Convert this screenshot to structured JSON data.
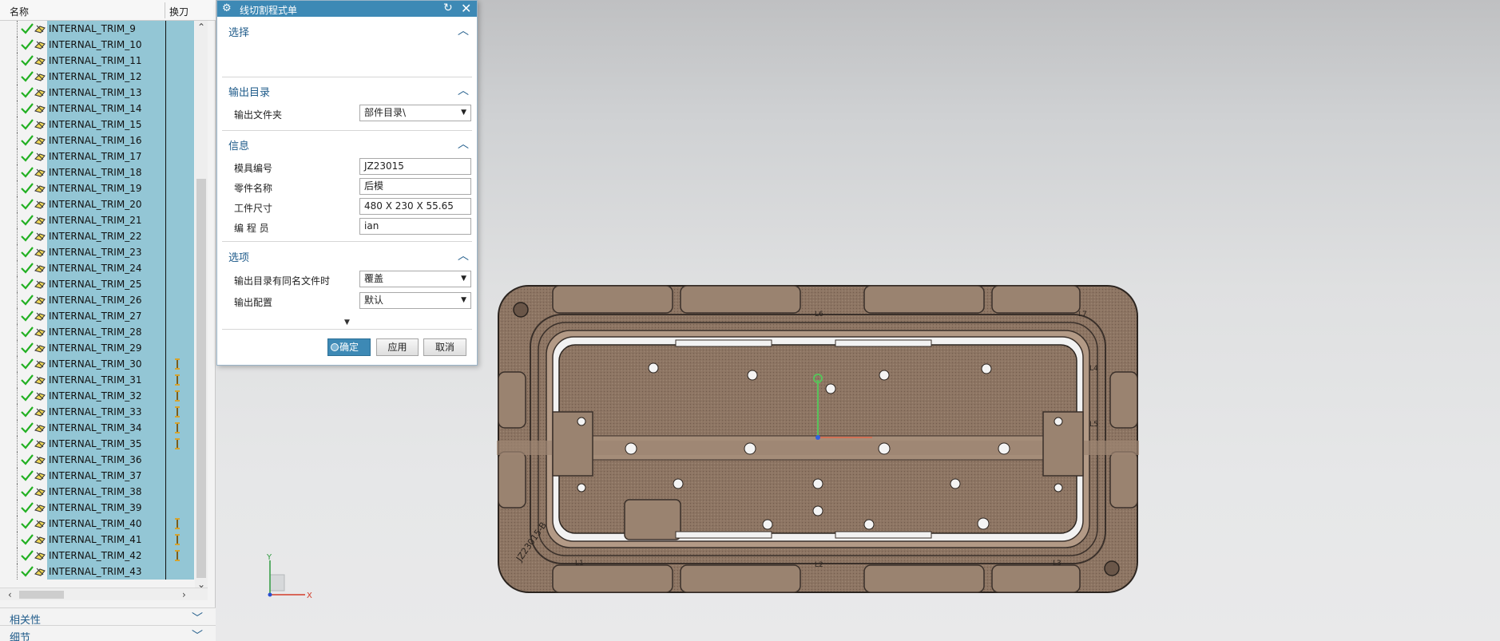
{
  "navigator": {
    "header": {
      "name_col": "名称",
      "tool_col": "换刀"
    },
    "rows": [
      {
        "name": "INTERNAL_TRIM_9",
        "tool_change": false
      },
      {
        "name": "INTERNAL_TRIM_10",
        "tool_change": false
      },
      {
        "name": "INTERNAL_TRIM_11",
        "tool_change": false
      },
      {
        "name": "INTERNAL_TRIM_12",
        "tool_change": false
      },
      {
        "name": "INTERNAL_TRIM_13",
        "tool_change": false
      },
      {
        "name": "INTERNAL_TRIM_14",
        "tool_change": false
      },
      {
        "name": "INTERNAL_TRIM_15",
        "tool_change": false
      },
      {
        "name": "INTERNAL_TRIM_16",
        "tool_change": false
      },
      {
        "name": "INTERNAL_TRIM_17",
        "tool_change": false
      },
      {
        "name": "INTERNAL_TRIM_18",
        "tool_change": false
      },
      {
        "name": "INTERNAL_TRIM_19",
        "tool_change": false
      },
      {
        "name": "INTERNAL_TRIM_20",
        "tool_change": false
      },
      {
        "name": "INTERNAL_TRIM_21",
        "tool_change": false
      },
      {
        "name": "INTERNAL_TRIM_22",
        "tool_change": false
      },
      {
        "name": "INTERNAL_TRIM_23",
        "tool_change": false
      },
      {
        "name": "INTERNAL_TRIM_24",
        "tool_change": false
      },
      {
        "name": "INTERNAL_TRIM_25",
        "tool_change": false
      },
      {
        "name": "INTERNAL_TRIM_26",
        "tool_change": false
      },
      {
        "name": "INTERNAL_TRIM_27",
        "tool_change": false
      },
      {
        "name": "INTERNAL_TRIM_28",
        "tool_change": false
      },
      {
        "name": "INTERNAL_TRIM_29",
        "tool_change": false
      },
      {
        "name": "INTERNAL_TRIM_30",
        "tool_change": true
      },
      {
        "name": "INTERNAL_TRIM_31",
        "tool_change": true
      },
      {
        "name": "INTERNAL_TRIM_32",
        "tool_change": true
      },
      {
        "name": "INTERNAL_TRIM_33",
        "tool_change": true
      },
      {
        "name": "INTERNAL_TRIM_34",
        "tool_change": true
      },
      {
        "name": "INTERNAL_TRIM_35",
        "tool_change": true
      },
      {
        "name": "INTERNAL_TRIM_36",
        "tool_change": false
      },
      {
        "name": "INTERNAL_TRIM_37",
        "tool_change": false
      },
      {
        "name": "INTERNAL_TRIM_38",
        "tool_change": false
      },
      {
        "name": "INTERNAL_TRIM_39",
        "tool_change": false
      },
      {
        "name": "INTERNAL_TRIM_40",
        "tool_change": true
      },
      {
        "name": "INTERNAL_TRIM_41",
        "tool_change": true
      },
      {
        "name": "INTERNAL_TRIM_42",
        "tool_change": true
      },
      {
        "name": "INTERNAL_TRIM_43",
        "tool_change": false
      }
    ],
    "sections": {
      "dependencies": "相关性",
      "details": "细节"
    }
  },
  "dialog": {
    "title": "线切割程式单",
    "groups": {
      "selection": "选择",
      "output_dir": "输出目录",
      "info": "信息",
      "options": "选项"
    },
    "fields": {
      "output_folder": {
        "label": "输出文件夹",
        "value": "部件目录\\"
      },
      "mold_no": {
        "label": "模具编号",
        "value": "JZ23015"
      },
      "part_name": {
        "label": "零件名称",
        "value": "后模"
      },
      "work_size": {
        "label": "工件尺寸",
        "value": "480 X 230 X 55.65"
      },
      "programmer": {
        "label": "编 程 员",
        "value": "ian"
      },
      "same_name": {
        "label": "输出目录有同名文件时",
        "value": "覆盖"
      },
      "config": {
        "label": "输出配置",
        "value": "默认"
      }
    },
    "buttons": {
      "ok": "确定",
      "apply": "应用",
      "cancel": "取消"
    }
  },
  "viewport": {
    "triad": {
      "x": "X",
      "y": "Y"
    },
    "model_engraving": "JZ23015-B",
    "model_labels": {
      "l1": "L1",
      "l2": "L2",
      "l3": "L3",
      "l4": "L4",
      "l5": "L5",
      "l6": "L6",
      "l7": "L7"
    }
  },
  "colors": {
    "selection_bg": "#93c6d5",
    "title_bar": "#3d89b5",
    "section_text": "#1f5b8a",
    "check": "#22b022",
    "model": "#8b7361"
  }
}
